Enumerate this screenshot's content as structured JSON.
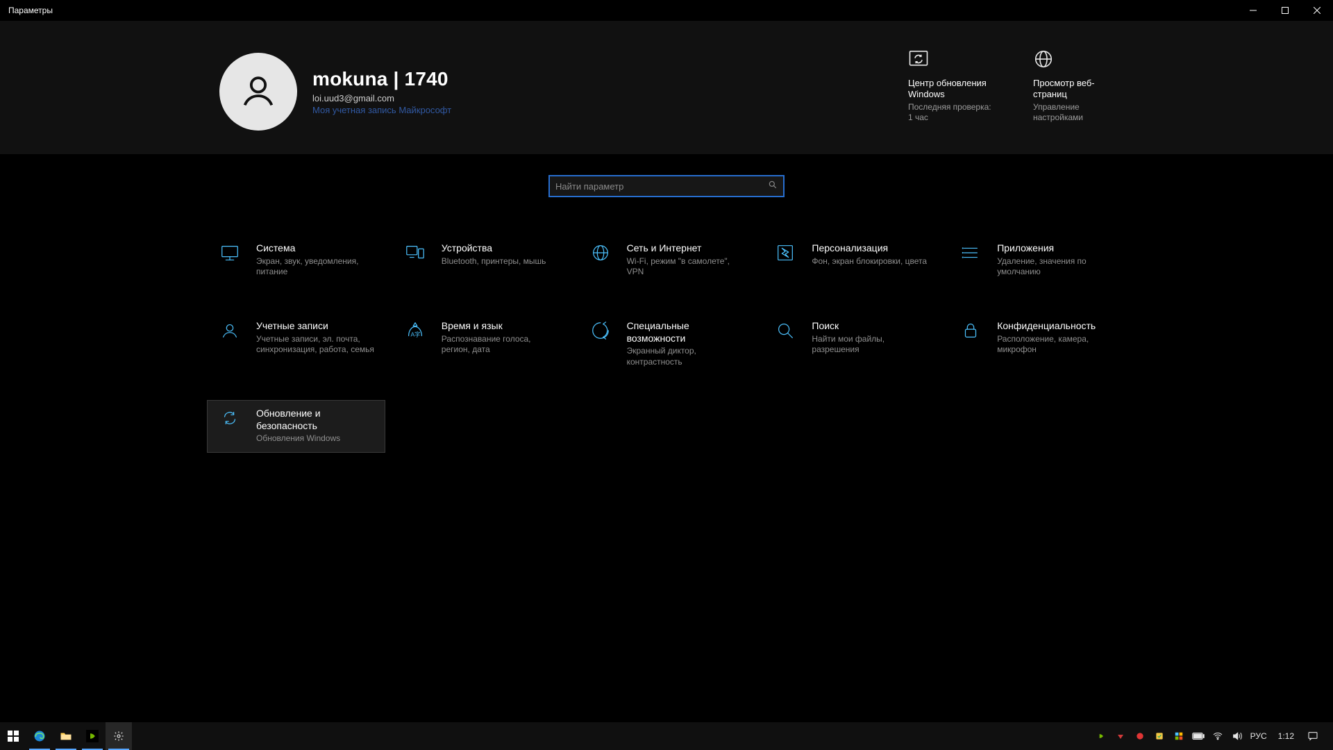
{
  "window": {
    "title": "Параметры"
  },
  "profile": {
    "name": "mokuna | 1740",
    "email": "loi.uud3@gmail.com",
    "ms_link": "Моя учетная запись Майкрософт"
  },
  "quick": [
    {
      "icon": "sync",
      "title": "Центр обновления Windows",
      "sub": "Последняя проверка: 1 час"
    },
    {
      "icon": "globe",
      "title": "Просмотр веб-страниц",
      "sub": "Управление настройками"
    }
  ],
  "search": {
    "placeholder": "Найти параметр"
  },
  "categories": [
    {
      "icon": "system",
      "title": "Система",
      "sub": "Экран, звук, уведомления, питание"
    },
    {
      "icon": "devices",
      "title": "Устройства",
      "sub": "Bluetooth, принтеры, мышь"
    },
    {
      "icon": "network",
      "title": "Сеть и Интернет",
      "sub": "Wi-Fi, режим \"в самолете\", VPN"
    },
    {
      "icon": "personal",
      "title": "Персонализация",
      "sub": "Фон, экран блокировки, цвета"
    },
    {
      "icon": "apps",
      "title": "Приложения",
      "sub": "Удаление, значения по умолчанию"
    },
    {
      "icon": "accounts",
      "title": "Учетные записи",
      "sub": "Учетные записи, эл. почта, синхронизация, работа, семья"
    },
    {
      "icon": "time",
      "title": "Время и язык",
      "sub": "Распознавание голоса, регион, дата"
    },
    {
      "icon": "ease",
      "title": "Специальные возможности",
      "sub": "Экранный диктор, контрастность"
    },
    {
      "icon": "search",
      "title": "Поиск",
      "sub": "Найти мои файлы, разрешения"
    },
    {
      "icon": "privacy",
      "title": "Конфиденциальность",
      "sub": "Расположение, камера, микрофон"
    },
    {
      "icon": "update",
      "title": "Обновление и безопасность",
      "sub": "Обновления Windows",
      "active": true
    }
  ],
  "taskbar": {
    "lang": "РУС",
    "time": "1:12"
  }
}
